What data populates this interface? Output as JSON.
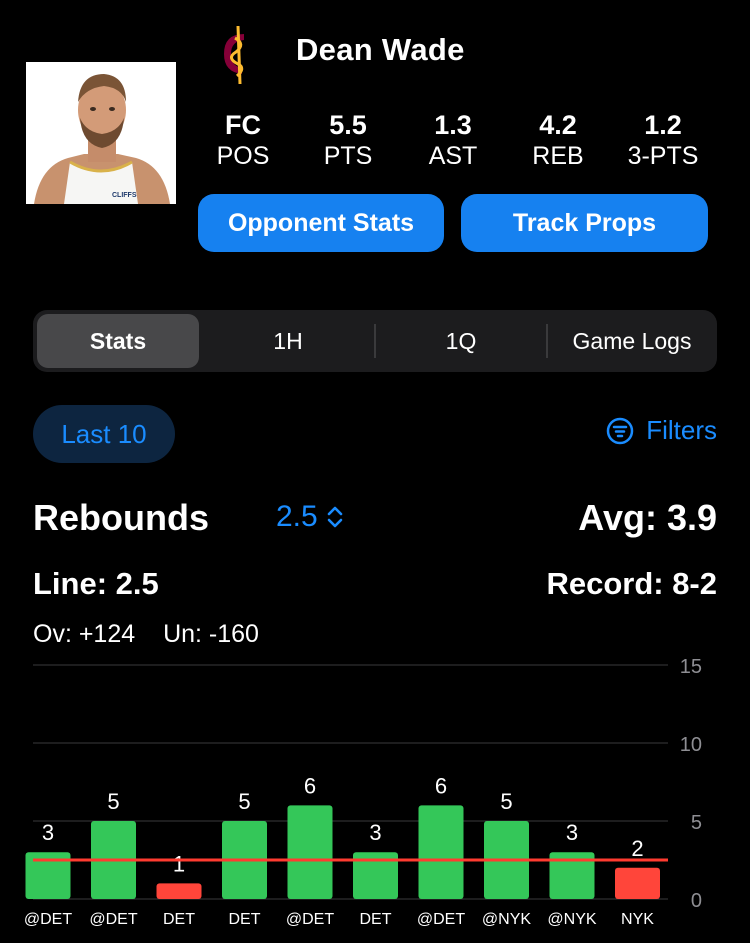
{
  "player": {
    "name": "Dean Wade",
    "team_colors": {
      "wine": "#860038",
      "gold": "#FDBB30"
    },
    "jersey_text": "CLIFFS"
  },
  "stats": [
    {
      "value": "FC",
      "label": "POS"
    },
    {
      "value": "5.5",
      "label": "PTS"
    },
    {
      "value": "1.3",
      "label": "AST"
    },
    {
      "value": "4.2",
      "label": "REB"
    },
    {
      "value": "1.2",
      "label": "3-PTS"
    }
  ],
  "buttons": {
    "opponent_stats": "Opponent Stats",
    "track_props": "Track Props"
  },
  "tabs": [
    "Stats",
    "1H",
    "1Q",
    "Game Logs"
  ],
  "active_tab": "Stats",
  "filter_row": {
    "range": "Last 10",
    "filters_label": "Filters"
  },
  "metric": {
    "name": "Rebounds",
    "line_value": "2.5",
    "avg": "Avg: 3.9",
    "line": "Line: 2.5",
    "record": "Record: 8-2",
    "over": "Ov: +124",
    "under": "Un: -160"
  },
  "colors": {
    "accent": "#1A8CFF",
    "over": "#34C759",
    "under": "#FF453A",
    "line": "#FF3B30"
  },
  "chart_data": {
    "type": "bar",
    "categories": [
      "@DET",
      "@DET",
      "DET",
      "DET",
      "@DET",
      "DET",
      "@DET",
      "@NYK",
      "@NYK",
      "NYK"
    ],
    "values": [
      3,
      5,
      1,
      5,
      6,
      3,
      6,
      5,
      3,
      2
    ],
    "line": 2.5,
    "ylim": [
      0,
      15
    ],
    "yticks": [
      0,
      5,
      10,
      15
    ],
    "grid": true
  }
}
